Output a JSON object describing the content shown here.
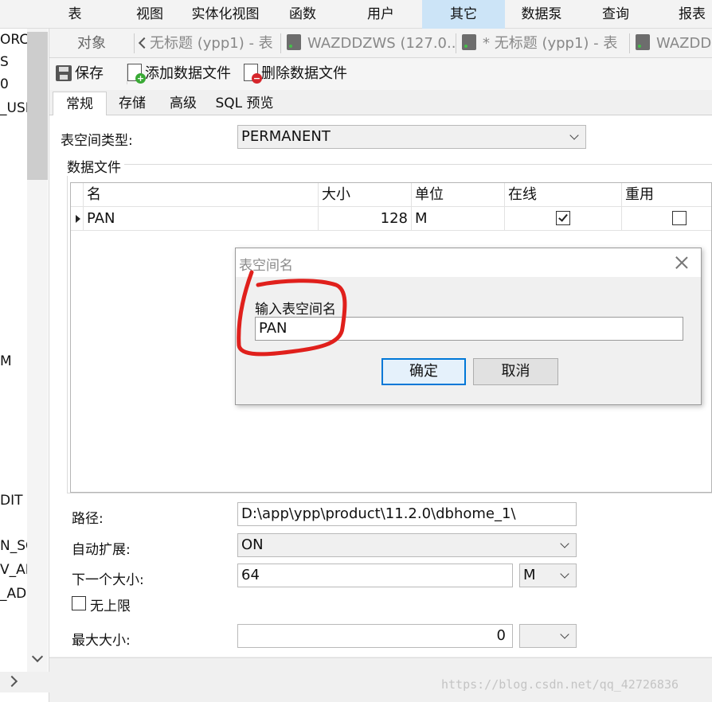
{
  "menu": {
    "items": [
      "表",
      "视图",
      "实体化视图",
      "函数",
      "用户",
      "其它",
      "数据泵",
      "查询",
      "报表"
    ],
    "active": "其它"
  },
  "tree": {
    "fragments": [
      "ORC",
      "S",
      "0",
      "_USE",
      "M",
      "DIT",
      "N_SC",
      "V_AD",
      "_AD"
    ]
  },
  "tabs": {
    "objects_label": "对象",
    "doc_tabs": [
      "无标题 (ypp1) - 表",
      "WAZDDZWS (127.0...",
      "* 无标题 (ypp1) - 表",
      "WAZDD"
    ]
  },
  "toolbar": {
    "save_label": "保存",
    "add_file_label": "添加数据文件",
    "delete_file_label": "删除数据文件"
  },
  "sub_tabs": [
    "常规",
    "存储",
    "高级",
    "SQL 预览"
  ],
  "form": {
    "tablespace_type_label": "表空间类型:",
    "tablespace_type_value": "PERMANENT",
    "datafiles_group_label": "数据文件",
    "path_label": "路径:",
    "path_value": "D:\\app\\ypp\\product\\11.2.0\\dbhome_1\\",
    "autoextend_label": "自动扩展:",
    "autoextend_value": "ON",
    "next_size_label": "下一个大小:",
    "next_size_value": "64",
    "next_size_unit": "M",
    "unlimited_label": "无上限",
    "max_size_label": "最大大小:",
    "max_size_value": "0"
  },
  "grid": {
    "columns": [
      "名",
      "大小",
      "单位",
      "在线",
      "重用"
    ],
    "rows": [
      {
        "name": "PAN",
        "size": "128",
        "unit": "M",
        "online": true,
        "reuse": false
      }
    ]
  },
  "dialog": {
    "title": "表空间名",
    "prompt": "输入表空间名",
    "input_value": "PAN",
    "ok_label": "确定",
    "cancel_label": "取消",
    "annotation_color": "#e0201c"
  },
  "watermark": "https://blog.csdn.net/qq_42726836"
}
